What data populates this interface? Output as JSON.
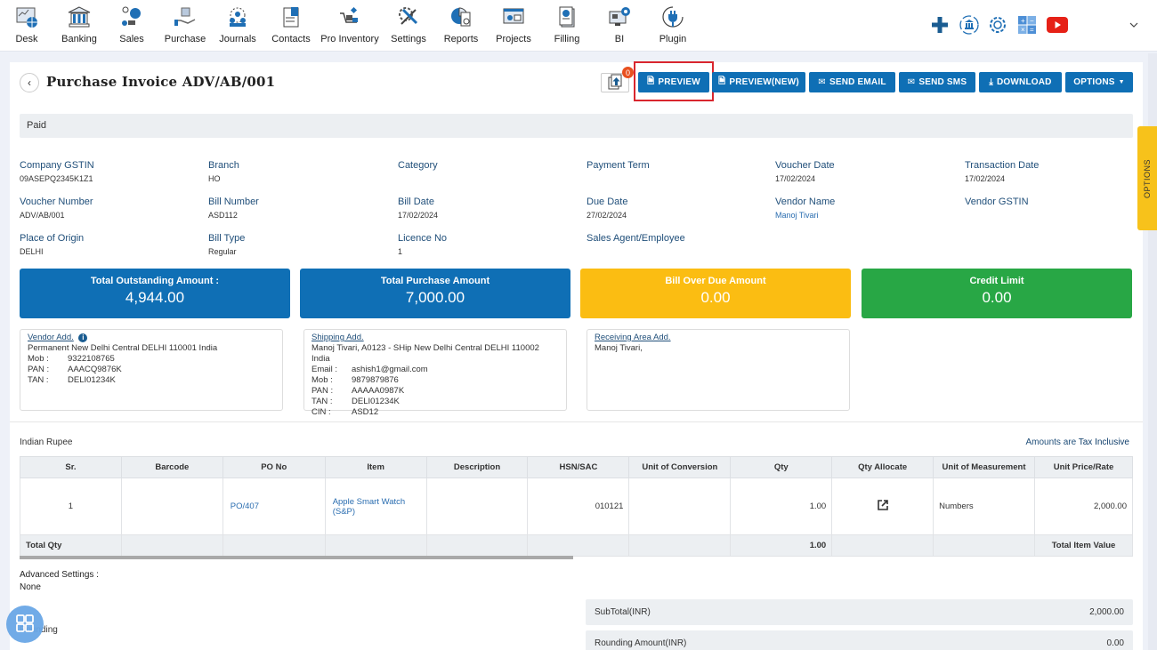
{
  "nav": {
    "items": [
      {
        "label": "Desk",
        "icon": "desk-icon"
      },
      {
        "label": "Banking",
        "icon": "bank-icon"
      },
      {
        "label": "Sales",
        "icon": "sales-icon"
      },
      {
        "label": "Purchase",
        "icon": "purchase-icon"
      },
      {
        "label": "Journals",
        "icon": "journals-icon"
      },
      {
        "label": "Contacts",
        "icon": "contacts-icon"
      },
      {
        "label": "Pro Inventory",
        "icon": "inventory-icon"
      },
      {
        "label": "Settings",
        "icon": "settings-icon"
      },
      {
        "label": "Reports",
        "icon": "reports-icon"
      },
      {
        "label": "Projects",
        "icon": "projects-icon"
      },
      {
        "label": "Filling",
        "icon": "filling-icon"
      },
      {
        "label": "BI",
        "icon": "bi-icon"
      },
      {
        "label": "Plugin",
        "icon": "plugin-icon"
      }
    ],
    "right_icons": [
      "plus-icon",
      "bank-sync-icon",
      "gear-icon",
      "calculator-icon",
      "youtube-icon",
      "chevron-down-icon"
    ]
  },
  "header": {
    "title": "Purchase Invoice ADV/AB/001",
    "attachment_count": "0",
    "buttons": {
      "preview": "PREVIEW",
      "preview_new": "PREVIEW(NEW)",
      "send_email": "SEND EMAIL",
      "send_sms": "SEND SMS",
      "download": "DOWNLOAD",
      "options": "OPTIONS"
    }
  },
  "status": "Paid",
  "fields": [
    {
      "label": "Company GSTIN",
      "value": "09ASEPQ2345K1Z1"
    },
    {
      "label": "Branch",
      "value": "HO"
    },
    {
      "label": "Category",
      "value": ""
    },
    {
      "label": "Payment Term",
      "value": ""
    },
    {
      "label": "Voucher Date",
      "value": "17/02/2024"
    },
    {
      "label": "Transaction Date",
      "value": "17/02/2024"
    },
    {
      "label": "Voucher Number",
      "value": "ADV/AB/001"
    },
    {
      "label": "Bill Number",
      "value": "ASD112"
    },
    {
      "label": "Bill Date",
      "value": "17/02/2024"
    },
    {
      "label": "Due Date",
      "value": "27/02/2024"
    },
    {
      "label": "Vendor Name",
      "value": "Manoj Tivari"
    },
    {
      "label": "Vendor GSTIN",
      "value": ""
    },
    {
      "label": "Place of Origin",
      "value": "DELHI"
    },
    {
      "label": "Bill Type",
      "value": "Regular"
    },
    {
      "label": "Licence No",
      "value": "1"
    },
    {
      "label": "Sales Agent/Employee",
      "value": ""
    }
  ],
  "cards": [
    {
      "title": "Total Outstanding Amount :",
      "value": "4,944.00",
      "color": "#0f6fb5"
    },
    {
      "title": "Total Purchase Amount",
      "value": "7,000.00",
      "color": "#0f6fb5"
    },
    {
      "title": "Bill Over Due Amount",
      "value": "0.00",
      "color": "#fbbd12"
    },
    {
      "title": "Credit Limit",
      "value": "0.00",
      "color": "#28a745"
    }
  ],
  "addresses": {
    "vendor": {
      "heading": "Vendor Add.",
      "line": "Permanent New Delhi Central DELHI 110001 India",
      "rows": [
        {
          "k": "Mob :",
          "v": "9322108765"
        },
        {
          "k": "PAN :",
          "v": "AAACQ9876K"
        },
        {
          "k": "TAN :",
          "v": "DELI01234K"
        }
      ]
    },
    "shipping": {
      "heading": "Shipping Add.",
      "line": "Manoj Tivari, A0123 - SHip New Delhi Central DELHI 110002 India",
      "rows": [
        {
          "k": "Email :",
          "v": "ashish1@gmail.com"
        },
        {
          "k": "Mob :",
          "v": "9879879876"
        },
        {
          "k": "PAN :",
          "v": "AAAAA0987K"
        },
        {
          "k": "TAN :",
          "v": "DELI01234K"
        },
        {
          "k": "CIN :",
          "v": "ASD12"
        }
      ]
    },
    "receiving": {
      "heading": "Receiving Area Add.",
      "line": "Manoj Tivari,"
    }
  },
  "table": {
    "currency": "Indian Rupee",
    "tax_note_prefix": "Amounts are ",
    "tax_note_value": "Tax Inclusive",
    "columns": [
      "Sr.",
      "Barcode",
      "PO No",
      "Item",
      "Description",
      "HSN/SAC",
      "Unit of Conversion",
      "Qty",
      "Qty Allocate",
      "Unit of Measurement",
      "Unit Price/Rate"
    ],
    "rows": [
      {
        "sr": "1",
        "barcode": "",
        "po_no": "PO/407",
        "item": "Apple Smart Watch (S&P)",
        "description": "",
        "hsn": "010121",
        "uoc": "",
        "qty": "1.00",
        "uom": "Numbers",
        "rate": "2,000.00"
      }
    ],
    "total": {
      "label": "Total Qty",
      "qty": "1.00",
      "item_value_label": "Total Item Value"
    }
  },
  "advanced": {
    "label": "Advanced Settings :",
    "value": "None"
  },
  "rounding_label": "Rounding",
  "summary": [
    {
      "label": "SubTotal(INR)",
      "value": "2,000.00"
    },
    {
      "label": "Rounding Amount(INR)",
      "value": "0.00"
    }
  ],
  "side_tab": "OPTIONS"
}
